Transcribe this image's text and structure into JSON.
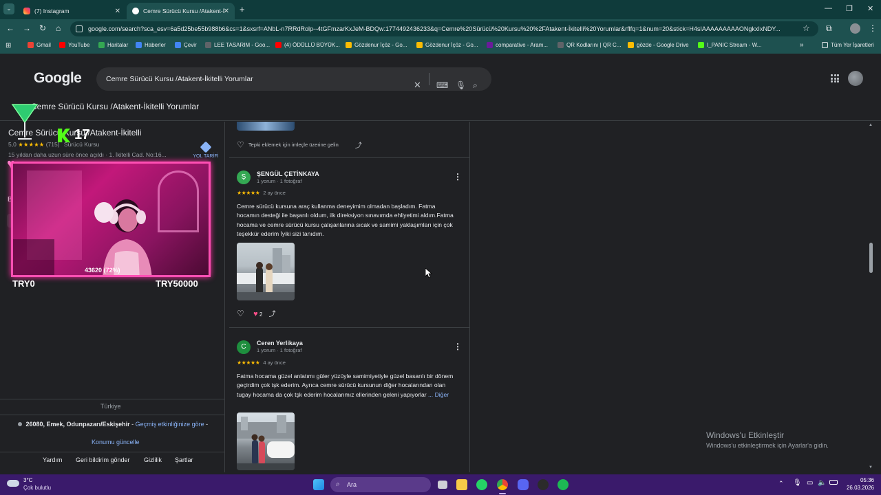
{
  "browser": {
    "tabs": [
      {
        "label": "(7) Instagram"
      },
      {
        "label": "Cemre Sürücü Kursu /Atakent-İ"
      }
    ],
    "url": "google.com/search?sca_esv=6a5d25be55b988b6&cs=1&sxsrf=ANbL-n7RRdRolp--4tGFmzarKxJeM-BDQw:1774492436233&q=Cemre%20Sürücü%20Kursu%20%2FAtakent-İkitelli%20Yorumlar&rflfq=1&num=20&stick=H4sIAAAAAAAAAONgkxIxNDY...",
    "bookmarks": [
      {
        "label": "Gmail",
        "color": "#ea4335"
      },
      {
        "label": "YouTube",
        "color": "#ff0000"
      },
      {
        "label": "Haritalar",
        "color": "#34a853"
      },
      {
        "label": "Haberler",
        "color": "#4285f4"
      },
      {
        "label": "Çevir",
        "color": "#4285f4"
      },
      {
        "label": "LEE TASARIM - Goo...",
        "color": "#5f6368"
      },
      {
        "label": "(4) ÖDÜLLÜ BÜYÜK...",
        "color": "#ff0000"
      },
      {
        "label": "Gözdenur İçöz - Go...",
        "color": "#fbbc04"
      },
      {
        "label": "Gözdenur İçöz - Go...",
        "color": "#fbbc04"
      },
      {
        "label": "comparative - Aram...",
        "color": "#6a1b9a"
      },
      {
        "label": "QR Kodlarını | QR C...",
        "color": "#5f6368"
      },
      {
        "label": "gözde - Google Drive",
        "color": "#fbbc04"
      },
      {
        "label": "I_PANIC Stream - W...",
        "color": "#53fc18"
      }
    ],
    "all_bookmarks_label": "Tüm Yer İşaretleri"
  },
  "google": {
    "logo": "Google",
    "query": "Cemre Sürücü Kursu /Atakent-İkitelli Yorumlar",
    "subtitle": "Cemre Sürücü Kursu /Atakent-İkitelli Yorumlar"
  },
  "place": {
    "name": "Cemre Sürücü Kursu /Atakent-İkitelli",
    "rating": "5,0",
    "stars": "★★★★★",
    "count": "(715)",
    "category": "Sürücü Kursu",
    "info": "15 yıldan daha uzun süre önce açıldı · 1. İkitelli Cad. No:16...",
    "directions": "YOL TARİFİ",
    "short_label": "Ba",
    "short_tag": "w"
  },
  "stream_overlay": {
    "badge": "17",
    "left_amount": "TRY0",
    "right_amount": "TRY50000",
    "progress_text": "43620 (72%)",
    "progress_fraction": 0.72
  },
  "reviews": {
    "top_reaction_hint": "Tepki eklemek için imleçle üzerine gelin",
    "items": [
      {
        "initial": "Ş",
        "avatar_color": "#34a853",
        "name": "ŞENGÜL ÇETİNKAYA",
        "meta": "1 yorum · 1 fotoğraf",
        "stars": "★★★★★",
        "date": "2 ay önce",
        "body": "Cemre sürücü kursuna araç kullanma deneyimim olmadan başladım. Fatma hocamın desteği ile başarılı oldum, ilk direksiyon sınavımda ehliyetimi aldım.Fatma hocama ve cemre sürücü kursu çalışanlarına sıcak ve samimi yaklaşımları için çok teşekkür ederim İyiki sizi tanıdım.",
        "likes": "2"
      },
      {
        "initial": "C",
        "avatar_color": "#1e8e3e",
        "name": "Ceren Yerlikaya",
        "meta": "1 yorum · 1 fotoğraf",
        "stars": "★★★★★",
        "date": "4 ay önce",
        "body": "Fatma hocama güzel anlatımı güler yüzüyle samimiyetiyle güzel basarılı bir dönem geçirdim çok tşk ederim. Ayrıca cemre sürücü kursunun diğer hocalarından olan tugay hocama da çok tşk ederim hocalarımız ellerinden geleni yapıyorlar",
        "more": "... Diğer"
      }
    ]
  },
  "footer": {
    "country": "Türkiye",
    "location": "26080, Emek, Odunpazarı/Eskişehir",
    "location_source": "Geçmiş etkinliğinize göre",
    "update_location": "Konumu güncelle",
    "links": [
      "Yardım",
      "Geri bildirim gönder",
      "Gizlilik",
      "Şartlar"
    ]
  },
  "activation": {
    "title": "Windows'u Etkinleştir",
    "subtitle": "Windows'u etkinleştirmek için Ayarlar'a gidin."
  },
  "taskbar": {
    "temp": "3°C",
    "weather": "Çok bulutlu",
    "search": "Ara",
    "time": "05:36",
    "date": "26.03.2026"
  }
}
